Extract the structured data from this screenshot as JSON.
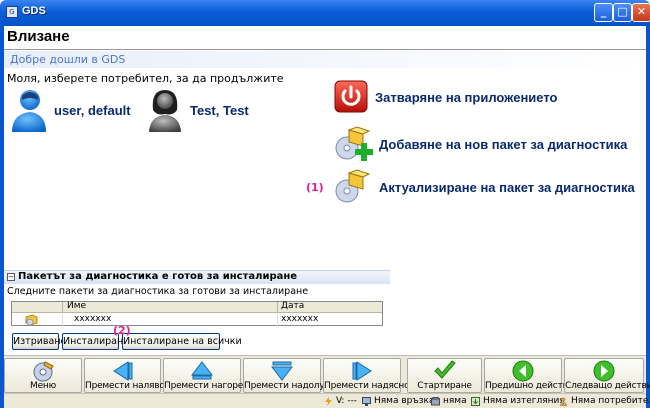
{
  "window": {
    "title": "GDS",
    "icon_text": "G",
    "min_glyph": "_",
    "max_glyph": "□",
    "close_glyph": "✕"
  },
  "page": {
    "title": "Влизане",
    "welcome": "Добре дошли в GDS",
    "prompt": "Моля, изберете потребител, за да продължите"
  },
  "users": [
    {
      "name": "user, default"
    },
    {
      "name": "Test, Test"
    }
  ],
  "actions": [
    {
      "label": "Затваряне на приложението"
    },
    {
      "label": "Добавяне на нов пакет за диагностика"
    },
    {
      "label": "Актуализиране на пакет за диагностика"
    }
  ],
  "callouts": {
    "one": "(1)",
    "two": "(2)"
  },
  "packages": {
    "header": "Пакетът за диагностика е готов за инсталиране",
    "toggle": "−",
    "subtitle": "Следните пакети за диагностика за готови за инсталиране",
    "columns": [
      "Име",
      "Дата"
    ],
    "rows": [
      {
        "name": "xxxxxxx",
        "date": "xxxxxxx"
      }
    ],
    "buttons": {
      "remove": "Изтриване",
      "install": "Инсталиране",
      "install_all": "Инсталиране на всички"
    }
  },
  "toolbar": {
    "menu": "Меню",
    "move_left": "Премести наляво",
    "move_up": "Премести нагоре",
    "move_down": "Премести надолу",
    "move_right": "Премести надясно",
    "start": "Стартиране",
    "prev": "Предишно действие",
    "next": "Следващо действие"
  },
  "status": {
    "version": "V: ---",
    "connection": "Няма връзка",
    "db": "няма",
    "measurements": "Няма изтегляния",
    "users": "Няма потребители"
  },
  "colors": {
    "titlebar": "#0a5ed8",
    "accent_text": "#0a2a6e",
    "callout": "#e0208f",
    "welcome": "#4b76c7"
  }
}
